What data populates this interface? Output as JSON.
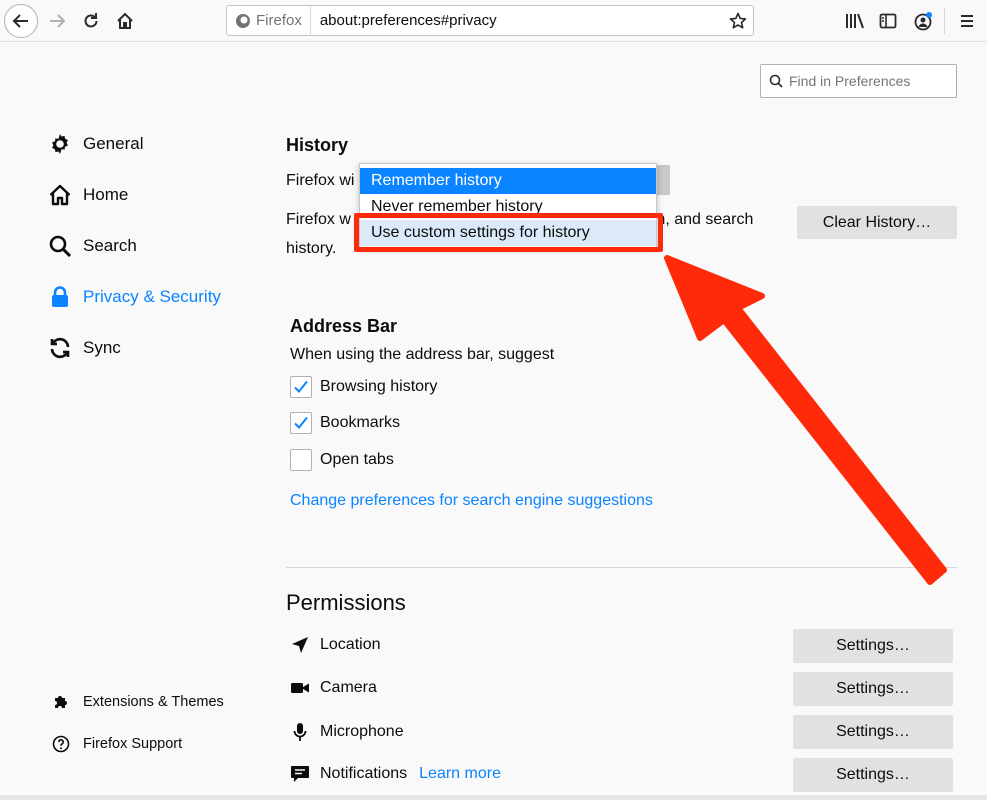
{
  "toolbar": {
    "identity_label": "Firefox",
    "url": "about:preferences#privacy"
  },
  "find": {
    "placeholder": "Find in Preferences"
  },
  "sidebar": {
    "items": [
      {
        "label": "General",
        "icon": "gear-icon"
      },
      {
        "label": "Home",
        "icon": "home-icon"
      },
      {
        "label": "Search",
        "icon": "search-icon"
      },
      {
        "label": "Privacy & Security",
        "icon": "lock-icon",
        "active": true
      },
      {
        "label": "Sync",
        "icon": "sync-icon"
      }
    ],
    "footer": [
      {
        "label": "Extensions & Themes",
        "icon": "puzzle-icon"
      },
      {
        "label": "Firefox Support",
        "icon": "help-icon"
      }
    ]
  },
  "history": {
    "title": "History",
    "will_text": "Firefox wi",
    "desc_left": "Firefox w",
    "desc_right": "m, and search",
    "desc_line2": "history.",
    "clear_button": "Clear History…",
    "dropdown": {
      "options": [
        "Remember history",
        "Never remember history",
        "Use custom settings for history"
      ],
      "selected_index": 0,
      "highlighted_index": 2
    }
  },
  "address_bar": {
    "title": "Address Bar",
    "subtitle": "When using the address bar, suggest",
    "options": [
      {
        "label": "Browsing history",
        "checked": true
      },
      {
        "label": "Bookmarks",
        "checked": true
      },
      {
        "label": "Open tabs",
        "checked": false
      }
    ],
    "link": "Change preferences for search engine suggestions"
  },
  "permissions": {
    "title": "Permissions",
    "items": [
      {
        "label": "Location",
        "icon": "location-arrow-icon",
        "button": "Settings…"
      },
      {
        "label": "Camera",
        "icon": "camera-icon",
        "button": "Settings…"
      },
      {
        "label": "Microphone",
        "icon": "microphone-icon",
        "button": "Settings…"
      },
      {
        "label": "Notifications",
        "icon": "notification-icon",
        "button": "Settings…",
        "link": "Learn more"
      }
    ]
  },
  "colors": {
    "accent": "#0a84ff",
    "annotation": "#ff2a0a"
  }
}
